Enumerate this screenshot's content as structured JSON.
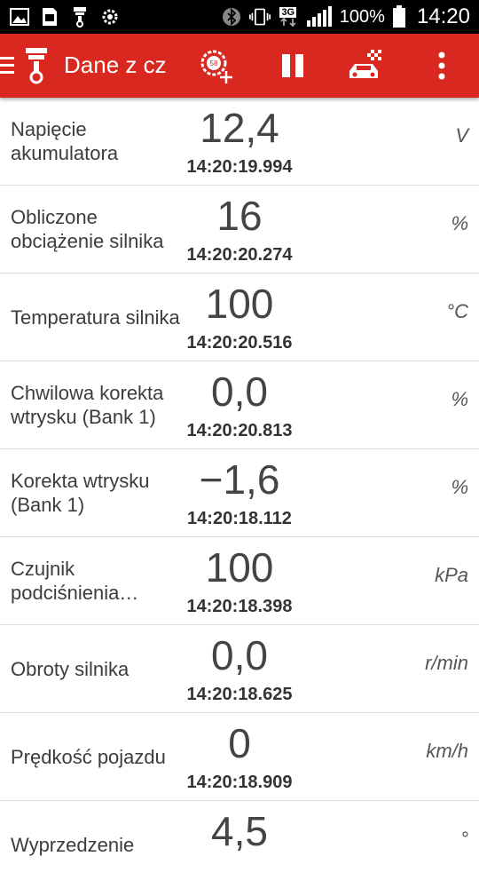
{
  "statusbar": {
    "battery_percent": "100%",
    "time": "14:20",
    "network_label": "3G",
    "left_icons": [
      "image-icon",
      "sim-3g-icon",
      "obd-plug-icon",
      "settings-gear-icon"
    ],
    "right_icons": [
      "bluetooth-icon",
      "vibrate-icon",
      "network-3g-icon",
      "signal-icon",
      "battery-icon"
    ]
  },
  "appbar": {
    "title": "Dane z cz",
    "background": "#d8281f",
    "actions": [
      "add-dashboard-gauge-icon",
      "pause-icon",
      "race-car-icon",
      "overflow-menu-icon"
    ]
  },
  "readings": [
    {
      "label": "Napięcie akumulatora",
      "value": "12,4",
      "time": "14:20:19.994",
      "unit": "V"
    },
    {
      "label": "Obliczone obciążenie silnika",
      "value": "16",
      "time": "14:20:20.274",
      "unit": "%"
    },
    {
      "label": "Temperatura silnika",
      "value": "100",
      "time": "14:20:20.516",
      "unit": "°C"
    },
    {
      "label": "Chwilowa korekta wtrysku (Bank 1)",
      "value": "0,0",
      "time": "14:20:20.813",
      "unit": "%"
    },
    {
      "label": "Korekta wtrysku (Bank 1)",
      "value": "−1,6",
      "time": "14:20:18.112",
      "unit": "%"
    },
    {
      "label": "Czujnik podciśnienia…",
      "value": "100",
      "time": "14:20:18.398",
      "unit": "kPa"
    },
    {
      "label": "Obroty silnika",
      "value": "0,0",
      "time": "14:20:18.625",
      "unit": "r/min"
    },
    {
      "label": "Prędkość pojazdu",
      "value": "0",
      "time": "14:20:18.909",
      "unit": "km/h"
    },
    {
      "label": "Wyprzedzenie",
      "value": "4,5",
      "time": "",
      "unit": "°"
    }
  ]
}
